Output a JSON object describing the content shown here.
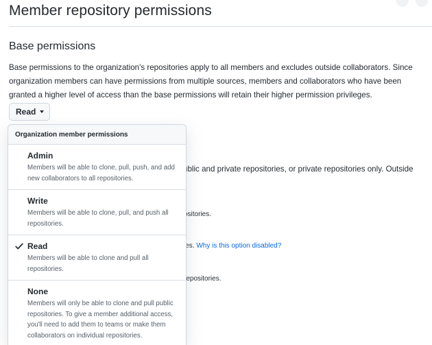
{
  "header": {
    "title": "Member repository permissions"
  },
  "base_permissions": {
    "title": "Base permissions",
    "description": "Base permissions to the organization's repositories apply to all members and excludes outside collaborators. Since organization members can have permissions from multiple sources, members and collaborators who have been granted a higher level of access than the base permissions will retain their higher permission privileges.",
    "selected_label": "Read"
  },
  "background": {
    "line1": "ublic and private repositories, or private repositories only. Outside",
    "line2": "ositories.",
    "line3_text": "ies.",
    "line3_link": "Why is this option disabled?",
    "line4": "repositories."
  },
  "dropdown": {
    "header": "Organization member permissions",
    "options": [
      {
        "title": "Admin",
        "description": "Members will be able to clone, pull, push, and add new collaborators to all repositories.",
        "selected": false
      },
      {
        "title": "Write",
        "description": "Members will be able to clone, pull, and push all repositories.",
        "selected": false
      },
      {
        "title": "Read",
        "description": "Members will be able to clone and pull all repositories.",
        "selected": true
      },
      {
        "title": "None",
        "description": "Members will only be able to clone and pull public repositories. To give a member additional access, you'll need to add them to teams or make them collaborators on individual repositories.",
        "selected": false
      }
    ]
  },
  "icons": {
    "check": "check-icon",
    "caret": "caret-down-icon"
  },
  "colors": {
    "link": "#0969da",
    "border": "#d0d7de",
    "text": "#24292f",
    "muted": "#57606a"
  }
}
